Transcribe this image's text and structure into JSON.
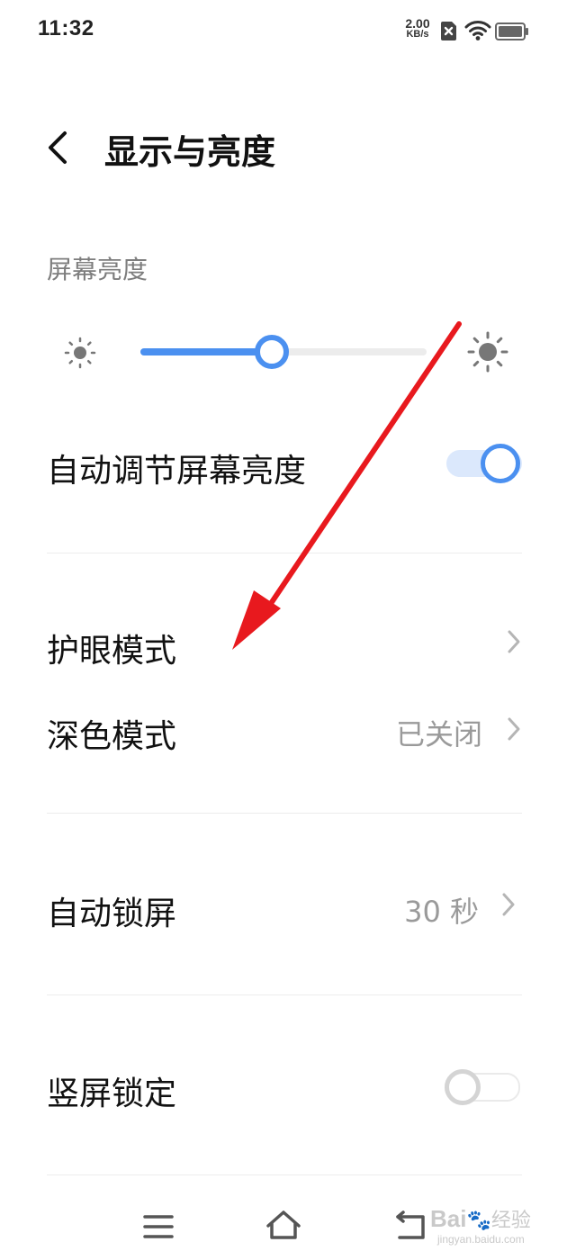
{
  "status_bar": {
    "time": "11:32",
    "net_speed_value": "2.00",
    "net_speed_unit": "KB/s",
    "icons": [
      "sim-x-icon",
      "wifi-icon",
      "battery-icon"
    ]
  },
  "header": {
    "title": "显示与亮度",
    "back_icon": "chevron-left-icon"
  },
  "brightness": {
    "section_label": "屏幕亮度",
    "level": 0.46,
    "accent_color": "#4b90f0",
    "icons": [
      "brightness-low-icon",
      "brightness-high-icon"
    ]
  },
  "settings": {
    "auto_brightness": {
      "label": "自动调节屏幕亮度",
      "enabled": true
    },
    "eye_protection": {
      "label": "护眼模式"
    },
    "dark_mode": {
      "label": "深色模式",
      "value": "已关闭"
    },
    "auto_lock": {
      "label": "自动锁屏",
      "value": "30 秒"
    },
    "portrait_lock": {
      "label": "竖屏锁定",
      "enabled": false
    }
  },
  "nav_bar": {
    "icons": [
      "menu-icon",
      "home-icon",
      "back-icon"
    ]
  },
  "annotation": {
    "arrow_color": "#e8191e"
  },
  "watermark": {
    "brand": "Bai",
    "brand_cn": "经验",
    "url": "jingyan.baidu.com"
  }
}
